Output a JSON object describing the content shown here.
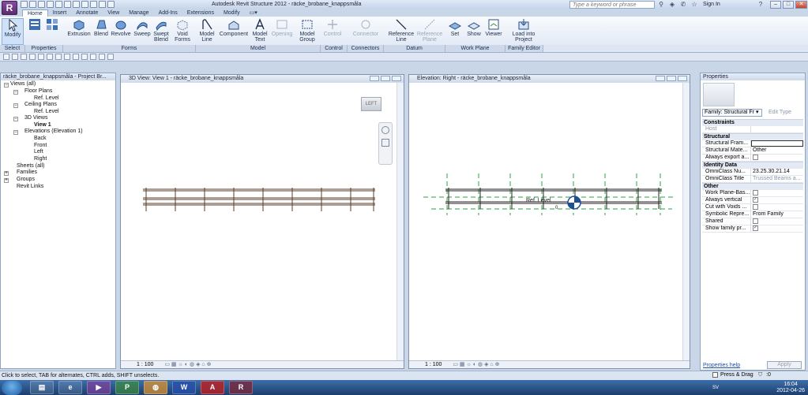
{
  "window": {
    "title": "Autodesk Revit Structure 2012 -    räcke_brobane_knappsmåla",
    "search_placeholder": "Type a keyword or phrase",
    "sign_in": "Sign In",
    "app_menu_letter": "R"
  },
  "ribbon": {
    "tabs": [
      "Home",
      "Insert",
      "Annotate",
      "View",
      "Manage",
      "Add-Ins",
      "Extensions",
      "Modify"
    ],
    "buttons": {
      "modify": "Modify",
      "extrusion": "Extrusion",
      "blend": "Blend",
      "revolve": "Revolve",
      "sweep": "Sweep",
      "swept_blend_1": "Swept",
      "swept_blend_2": "Blend",
      "void_forms_1": "Void",
      "void_forms_2": "Forms",
      "model_line_1": "Model",
      "model_line_2": "Line",
      "component": "Component",
      "model_text_1": "Model",
      "model_text_2": "Text",
      "opening": "Opening",
      "model_group_1": "Model",
      "model_group_2": "Group",
      "control": "Control",
      "connector": "Connector",
      "reference_line_1": "Reference",
      "reference_line_2": "Line",
      "reference_plane_1": "Reference",
      "reference_plane_2": "Plane",
      "set": "Set",
      "show": "Show",
      "viewer": "Viewer",
      "load_into_1": "Load into",
      "load_into_2": "Project"
    },
    "panels": {
      "select": "Select",
      "properties": "Properties",
      "forms": "Forms",
      "model": "Model",
      "control": "Control",
      "connectors": "Connectors",
      "datum": "Datum",
      "work_plane": "Work Plane",
      "family_editor": "Family Editor"
    }
  },
  "project_browser": {
    "title": "räcke_brobane_knappsmåla - Project Br...",
    "items": {
      "views_all": "Views (all)",
      "floor_plans": "Floor Plans",
      "ref_level": "Ref. Level",
      "ceiling_plans": "Ceiling Plans",
      "ref_level_2": "Ref. Level",
      "views_3d": "3D Views",
      "view_1": "View 1",
      "elevations": "Elevations (Elevation 1)",
      "back": "Back",
      "front": "Front",
      "left": "Left",
      "right": "Right",
      "sheets": "Sheets (all)",
      "families": "Families",
      "groups": "Groups",
      "revit_links": "Revit Links"
    }
  },
  "view3d": {
    "title": "3D View: View 1 - räcke_brobane_knappsmåla",
    "viewcube_label": "LEFT",
    "scale": "1 : 100"
  },
  "elevation": {
    "title": "Elevation: Right - räcke_brobane_knappsmåla",
    "level_label": "Ref. Level",
    "level_value": "0",
    "scale": "1 : 100"
  },
  "properties": {
    "title": "Properties",
    "type_selector": "Family: Structural Fr",
    "edit_type": "Edit Type",
    "groups": {
      "constraints": "Constraints",
      "structural": "Structural",
      "identity_data": "Identity Data",
      "other": "Other"
    },
    "rows": {
      "host": "Host",
      "structural_framing": "Structural Fram...",
      "structural_material": "Structural Mate...",
      "structural_material_value": "Other",
      "always_export": "Always export a...",
      "omniclass_number": "OmniClass Nu...",
      "omniclass_number_value": "23.25.30.21.14",
      "omniclass_title": "OmniClass Title",
      "omniclass_title_value": "Trussed Beams a...",
      "work_plane_based": "Work Plane-Bas...",
      "always_vertical": "Always vertical",
      "cut_with_voids": "Cut with Voids ...",
      "symbolic_repr": "Symbolic Repre...",
      "symbolic_repr_value": "From Family",
      "shared": "Shared",
      "show_family": "Show family pr..."
    },
    "help_link": "Properties help",
    "apply": "Apply"
  },
  "status": {
    "message": "Click to select, TAB for alternates, CTRL adds, SHIFT unselects.",
    "press_drag": "Press & Drag",
    "filter_count": ":0"
  },
  "taskbar": {
    "lang": "SV",
    "time": "16:04",
    "date": "2012-04-26"
  },
  "colors": {
    "accent": "#1e4f8f",
    "level_green": "#2ea043"
  }
}
